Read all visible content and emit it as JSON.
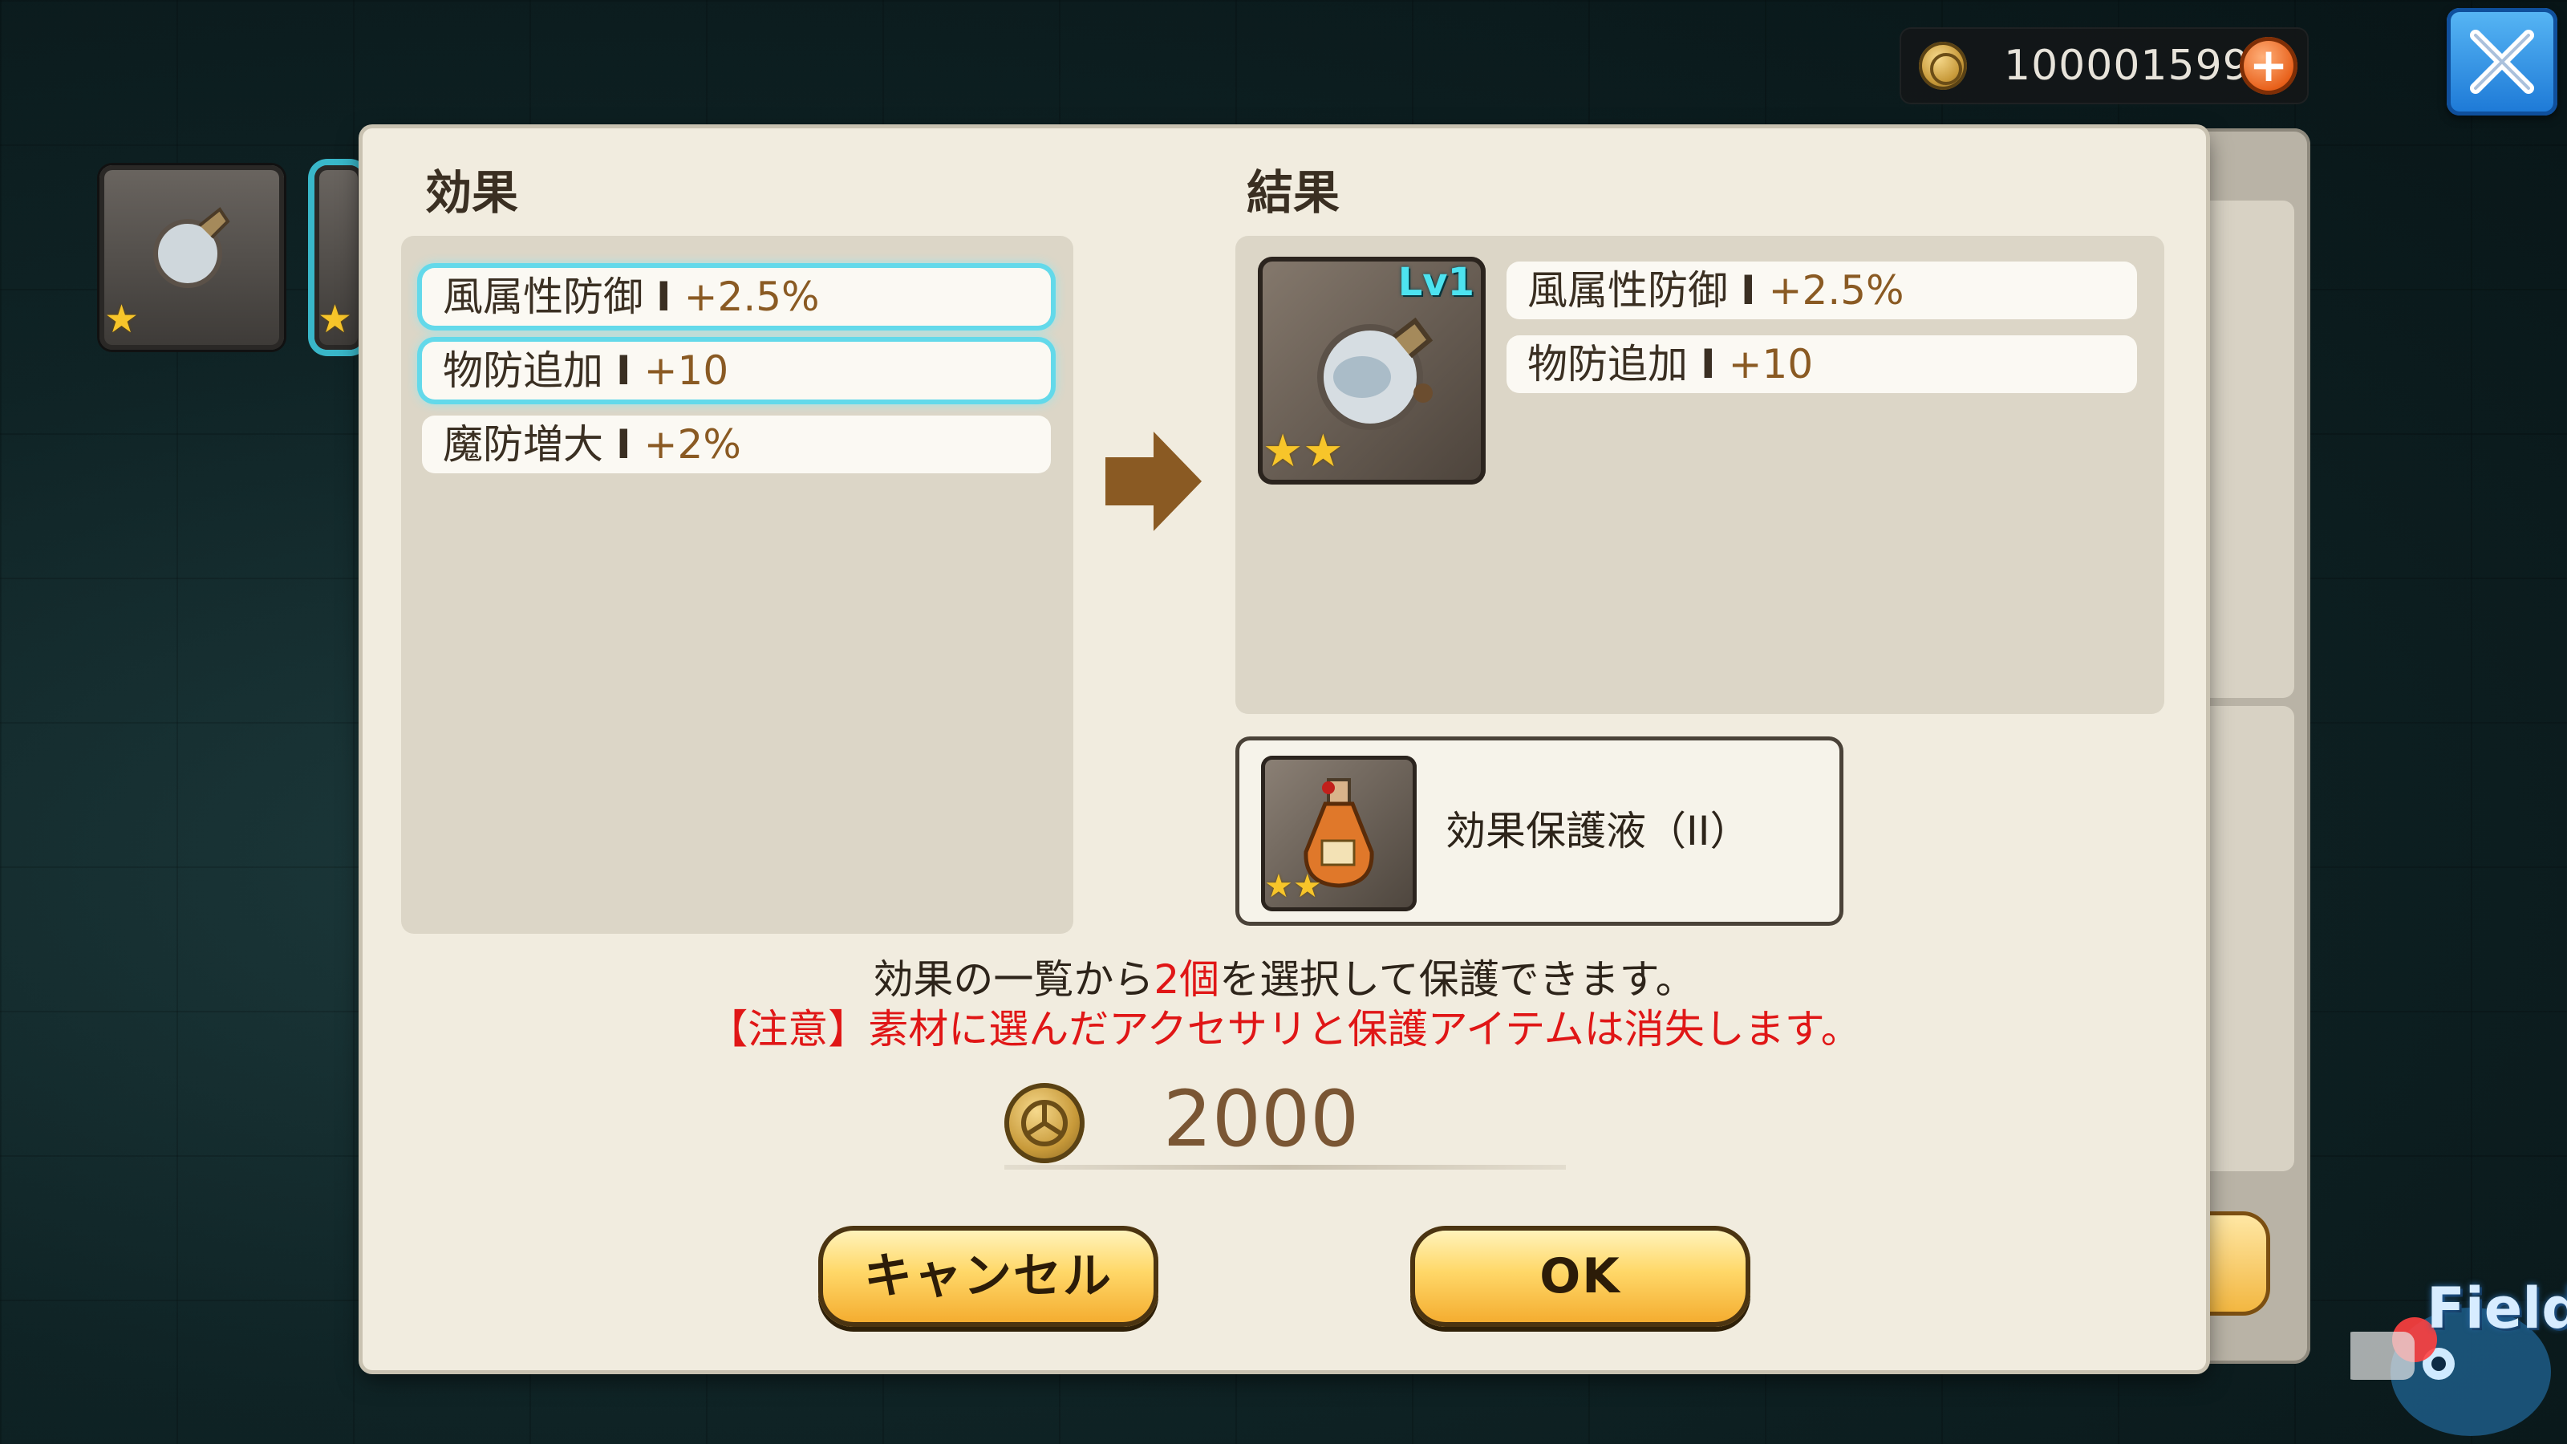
{
  "currency": {
    "amount": "100001599",
    "plus": "+"
  },
  "dialog": {
    "effects_title": "効果",
    "result_title": "結果",
    "effects": [
      {
        "name": "風属性防御",
        "sep": "I",
        "value": "+2.5%",
        "selected": true
      },
      {
        "name": "物防追加",
        "sep": "I",
        "value": "+10",
        "selected": true
      },
      {
        "name": "魔防増大",
        "sep": "I",
        "value": "+2%",
        "selected": false
      }
    ],
    "result_item": {
      "level": "Lv1",
      "stars": "★★"
    },
    "result_effects": [
      {
        "name": "風属性防御",
        "sep": "I",
        "value": "+2.5%"
      },
      {
        "name": "物防追加",
        "sep": "I",
        "value": "+10"
      }
    ],
    "protect_item": {
      "label": "効果保護液（II）",
      "stars": "★★"
    },
    "message_pre": "効果の一覧から",
    "message_count": "2個",
    "message_post": "を選択して保護できます。",
    "warning": "【注意】素材に選んだアクセサリと保護アイテムは消失します。",
    "cost": "2000",
    "cancel_label": "キャンセル",
    "ok_label": "OK"
  },
  "background": {
    "field_label": "Field"
  },
  "thumbs": [
    {
      "stars": "★"
    },
    {
      "stars": "★"
    }
  ],
  "colors": {
    "accent_red": "#e01616",
    "selected_glow": "#63d9ea",
    "button": "#ffd869"
  }
}
